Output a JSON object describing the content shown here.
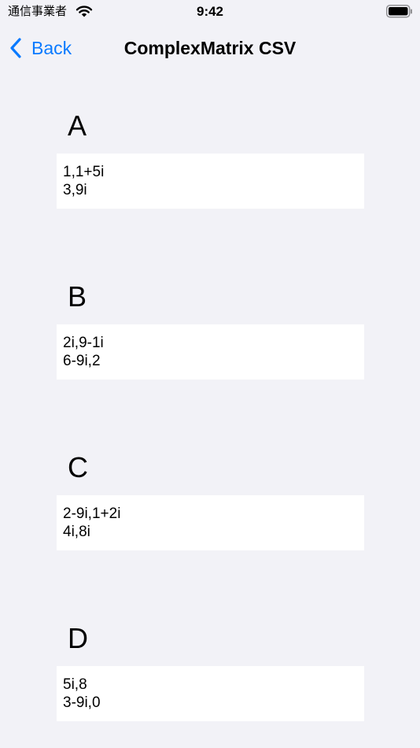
{
  "status_bar": {
    "carrier": "通信事業者",
    "time": "9:42"
  },
  "nav": {
    "back_label": "Back",
    "title": "ComplexMatrix CSV"
  },
  "matrices": [
    {
      "label": "A",
      "csv_lines": [
        "1,1+5i",
        "3,9i"
      ]
    },
    {
      "label": "B",
      "csv_lines": [
        "2i,9-1i",
        "6-9i,2"
      ]
    },
    {
      "label": "C",
      "csv_lines": [
        "2-9i,1+2i",
        "4i,8i"
      ]
    },
    {
      "label": "D",
      "csv_lines": [
        "5i,8",
        "3-9i,0"
      ]
    }
  ],
  "colors": {
    "background": "#f2f2f7",
    "accent": "#0a7aff",
    "field_background": "#ffffff"
  }
}
